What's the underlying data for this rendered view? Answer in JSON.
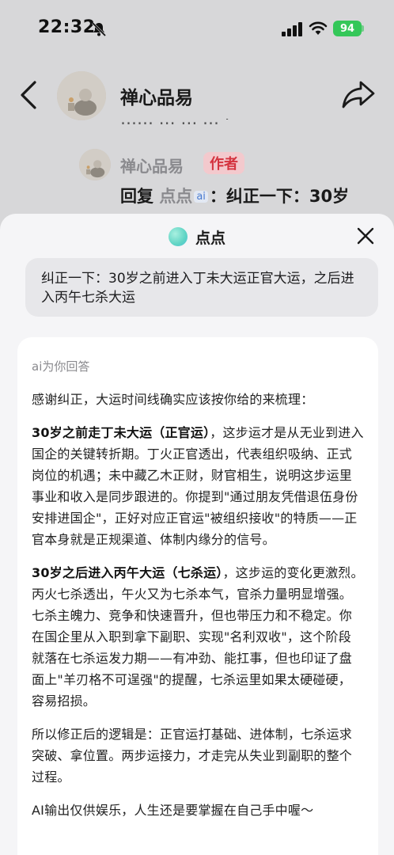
{
  "status": {
    "time": "22:32",
    "battery": "94"
  },
  "header": {
    "name": "禅心品易"
  },
  "background": {
    "clipped_text": "…… … … … ·"
  },
  "reply": {
    "name": "禅心品易",
    "badge": "作者",
    "prefix": "回复",
    "target": "点点",
    "ai_tag": "ai",
    "text": "：纠正一下：30岁"
  },
  "sheet": {
    "title": "点点",
    "question": "纠正一下：30岁之前进入丁未大运正官大运，之后进入丙午七杀大运",
    "answer_label": "ai为你回答",
    "paragraphs": [
      {
        "bold": "",
        "text": "感谢纠正，大运时间线确实应该按你给的来梳理："
      },
      {
        "bold": "30岁之前走丁未大运（正官运）",
        "text": "，这步运才是从无业到进入国企的关键转折期。丁火正官透出，代表组织吸纳、正式岗位的机遇；未中藏乙木正财，财官相生，说明这步运里事业和收入是同步跟进的。你提到\"通过朋友凭借退伍身份安排进国企\"，正好对应正官运\"被组织接收\"的特质——正官本身就是正规渠道、体制内缘分的信号。"
      },
      {
        "bold": "30岁之后进入丙午大运（七杀运）",
        "text": "，这步运的变化更激烈。丙火七杀透出，午火又为七杀本气，官杀力量明显增强。七杀主魄力、竞争和快速晋升，但也带压力和不稳定。你在国企里从入职到拿下副职、实现\"名利双收\"，这个阶段就落在七杀运发力期——有冲劲、能扛事，但也印证了盘面上\"羊刃格不可逞强\"的提醒，七杀运里如果太硬碰硬，容易招损。"
      },
      {
        "bold": "",
        "text": "所以修正后的逻辑是：正官运打基础、进体制，七杀运求突破、拿位置。两步运接力，才走完从失业到副职的整个过程。"
      },
      {
        "bold": "",
        "text": "AI输出仅供娱乐，人生还是要掌握在自己手中喔～"
      }
    ]
  }
}
